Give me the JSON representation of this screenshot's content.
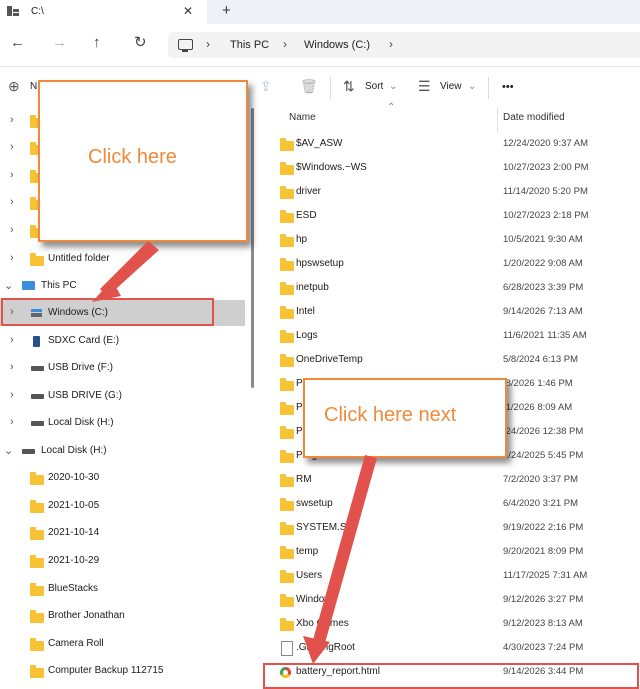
{
  "window": {
    "tab_title": "C:\\",
    "close_glyph": "✕",
    "new_tab_glyph": "+"
  },
  "address": {
    "crumbs": [
      "This PC",
      "Windows (C:)"
    ]
  },
  "toolbar": {
    "new_label": "N",
    "sort_label": "Sort",
    "view_label": "View",
    "more_label": "•••"
  },
  "nav": {
    "untitled_folder": "Untitled folder",
    "this_pc": "This PC",
    "windows_c": "Windows (C:)",
    "sdxc": "SDXC Card (E:)",
    "usb_f": "USB Drive (F:)",
    "usb_g": "USB DRIVE (G:)",
    "local_h": "Local Disk (H:)",
    "local_h_expanded": "Local Disk (H:)",
    "children": [
      "2020-10-30",
      "2021-10-05",
      "2021-10-14",
      "2021-10-29",
      "BlueStacks",
      "Brother Jonathan",
      "Camera Roll",
      "Computer Backup 112715"
    ]
  },
  "columns": {
    "name": "Name",
    "date": "Date modified"
  },
  "files": [
    {
      "name": "$AV_ASW",
      "date": "12/24/2020 9:37 AM"
    },
    {
      "name": "$Windows.~WS",
      "date": "10/27/2023 2:00 PM"
    },
    {
      "name": "driver",
      "date": "11/14/2020 5:20 PM"
    },
    {
      "name": "ESD",
      "date": "10/27/2023 2:18 PM"
    },
    {
      "name": "hp",
      "date": "10/5/2021 9:30 AM"
    },
    {
      "name": "hpswsetup",
      "date": "1/20/2022 9:08 AM"
    },
    {
      "name": "inetpub",
      "date": "6/28/2023 3:39 PM"
    },
    {
      "name": "Intel",
      "date": "9/14/2026 7:13 AM"
    },
    {
      "name": "Logs",
      "date": "11/6/2021 11:35 AM"
    },
    {
      "name": "OneDriveTemp",
      "date": "5/8/2024 6:13 PM"
    },
    {
      "name": "P",
      "date": "/8/2026 1:46 PM"
    },
    {
      "name": "P",
      "date": "/1/2026 8:09 AM"
    },
    {
      "name": "P",
      "date": "/24/2026 12:38 PM"
    },
    {
      "name": "ProgramData",
      "date": "1/24/2025 5:45 PM"
    },
    {
      "name": "RM",
      "date": "7/2/2020 3:37 PM"
    },
    {
      "name": "swsetup",
      "date": "6/4/2020 3:21 PM"
    },
    {
      "name": "SYSTEM.S",
      "date": "9/19/2022 2:16 PM"
    },
    {
      "name": "temp",
      "date": "9/20/2021 8:09 PM"
    },
    {
      "name": "Users",
      "date": "11/17/2025 7:31 AM"
    },
    {
      "name": "Windows",
      "date": "9/12/2026 3:27 PM"
    },
    {
      "name": "Xbo  Games",
      "date": "9/12/2023 8:13 AM"
    },
    {
      "name": ".GamingRoot",
      "date": "4/30/2023 7:24 PM"
    },
    {
      "name": "battery_report.html",
      "date": "9/14/2026 3:44 PM"
    }
  ],
  "annotations": {
    "callout1": "Click here",
    "callout2": "Click here next",
    "color": "#ef8a3c",
    "highlight_color": "#e0524b"
  }
}
